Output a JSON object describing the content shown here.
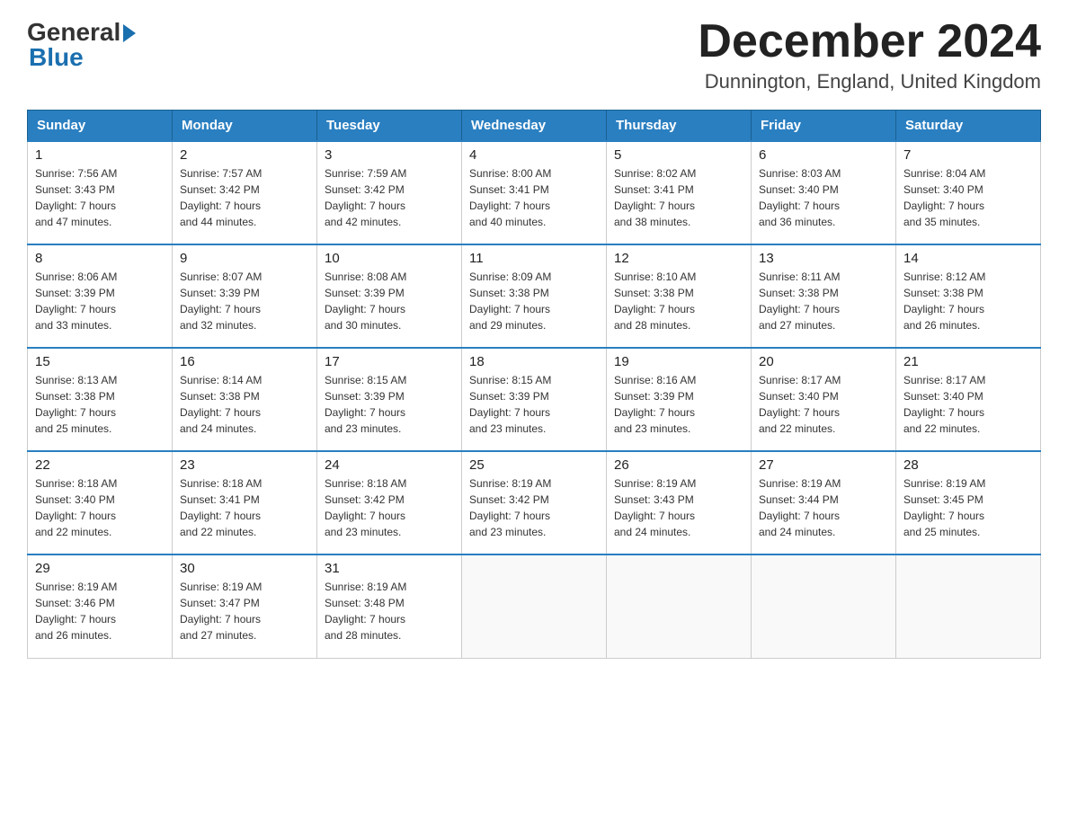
{
  "header": {
    "logo_general": "General",
    "logo_blue": "Blue",
    "month_title": "December 2024",
    "location": "Dunnington, England, United Kingdom"
  },
  "weekdays": [
    "Sunday",
    "Monday",
    "Tuesday",
    "Wednesday",
    "Thursday",
    "Friday",
    "Saturday"
  ],
  "weeks": [
    [
      {
        "day": "1",
        "sunrise": "7:56 AM",
        "sunset": "3:43 PM",
        "daylight": "7 hours and 47 minutes."
      },
      {
        "day": "2",
        "sunrise": "7:57 AM",
        "sunset": "3:42 PM",
        "daylight": "7 hours and 44 minutes."
      },
      {
        "day": "3",
        "sunrise": "7:59 AM",
        "sunset": "3:42 PM",
        "daylight": "7 hours and 42 minutes."
      },
      {
        "day": "4",
        "sunrise": "8:00 AM",
        "sunset": "3:41 PM",
        "daylight": "7 hours and 40 minutes."
      },
      {
        "day": "5",
        "sunrise": "8:02 AM",
        "sunset": "3:41 PM",
        "daylight": "7 hours and 38 minutes."
      },
      {
        "day": "6",
        "sunrise": "8:03 AM",
        "sunset": "3:40 PM",
        "daylight": "7 hours and 36 minutes."
      },
      {
        "day": "7",
        "sunrise": "8:04 AM",
        "sunset": "3:40 PM",
        "daylight": "7 hours and 35 minutes."
      }
    ],
    [
      {
        "day": "8",
        "sunrise": "8:06 AM",
        "sunset": "3:39 PM",
        "daylight": "7 hours and 33 minutes."
      },
      {
        "day": "9",
        "sunrise": "8:07 AM",
        "sunset": "3:39 PM",
        "daylight": "7 hours and 32 minutes."
      },
      {
        "day": "10",
        "sunrise": "8:08 AM",
        "sunset": "3:39 PM",
        "daylight": "7 hours and 30 minutes."
      },
      {
        "day": "11",
        "sunrise": "8:09 AM",
        "sunset": "3:38 PM",
        "daylight": "7 hours and 29 minutes."
      },
      {
        "day": "12",
        "sunrise": "8:10 AM",
        "sunset": "3:38 PM",
        "daylight": "7 hours and 28 minutes."
      },
      {
        "day": "13",
        "sunrise": "8:11 AM",
        "sunset": "3:38 PM",
        "daylight": "7 hours and 27 minutes."
      },
      {
        "day": "14",
        "sunrise": "8:12 AM",
        "sunset": "3:38 PM",
        "daylight": "7 hours and 26 minutes."
      }
    ],
    [
      {
        "day": "15",
        "sunrise": "8:13 AM",
        "sunset": "3:38 PM",
        "daylight": "7 hours and 25 minutes."
      },
      {
        "day": "16",
        "sunrise": "8:14 AM",
        "sunset": "3:38 PM",
        "daylight": "7 hours and 24 minutes."
      },
      {
        "day": "17",
        "sunrise": "8:15 AM",
        "sunset": "3:39 PM",
        "daylight": "7 hours and 23 minutes."
      },
      {
        "day": "18",
        "sunrise": "8:15 AM",
        "sunset": "3:39 PM",
        "daylight": "7 hours and 23 minutes."
      },
      {
        "day": "19",
        "sunrise": "8:16 AM",
        "sunset": "3:39 PM",
        "daylight": "7 hours and 23 minutes."
      },
      {
        "day": "20",
        "sunrise": "8:17 AM",
        "sunset": "3:40 PM",
        "daylight": "7 hours and 22 minutes."
      },
      {
        "day": "21",
        "sunrise": "8:17 AM",
        "sunset": "3:40 PM",
        "daylight": "7 hours and 22 minutes."
      }
    ],
    [
      {
        "day": "22",
        "sunrise": "8:18 AM",
        "sunset": "3:40 PM",
        "daylight": "7 hours and 22 minutes."
      },
      {
        "day": "23",
        "sunrise": "8:18 AM",
        "sunset": "3:41 PM",
        "daylight": "7 hours and 22 minutes."
      },
      {
        "day": "24",
        "sunrise": "8:18 AM",
        "sunset": "3:42 PM",
        "daylight": "7 hours and 23 minutes."
      },
      {
        "day": "25",
        "sunrise": "8:19 AM",
        "sunset": "3:42 PM",
        "daylight": "7 hours and 23 minutes."
      },
      {
        "day": "26",
        "sunrise": "8:19 AM",
        "sunset": "3:43 PM",
        "daylight": "7 hours and 24 minutes."
      },
      {
        "day": "27",
        "sunrise": "8:19 AM",
        "sunset": "3:44 PM",
        "daylight": "7 hours and 24 minutes."
      },
      {
        "day": "28",
        "sunrise": "8:19 AM",
        "sunset": "3:45 PM",
        "daylight": "7 hours and 25 minutes."
      }
    ],
    [
      {
        "day": "29",
        "sunrise": "8:19 AM",
        "sunset": "3:46 PM",
        "daylight": "7 hours and 26 minutes."
      },
      {
        "day": "30",
        "sunrise": "8:19 AM",
        "sunset": "3:47 PM",
        "daylight": "7 hours and 27 minutes."
      },
      {
        "day": "31",
        "sunrise": "8:19 AM",
        "sunset": "3:48 PM",
        "daylight": "7 hours and 28 minutes."
      },
      null,
      null,
      null,
      null
    ]
  ]
}
